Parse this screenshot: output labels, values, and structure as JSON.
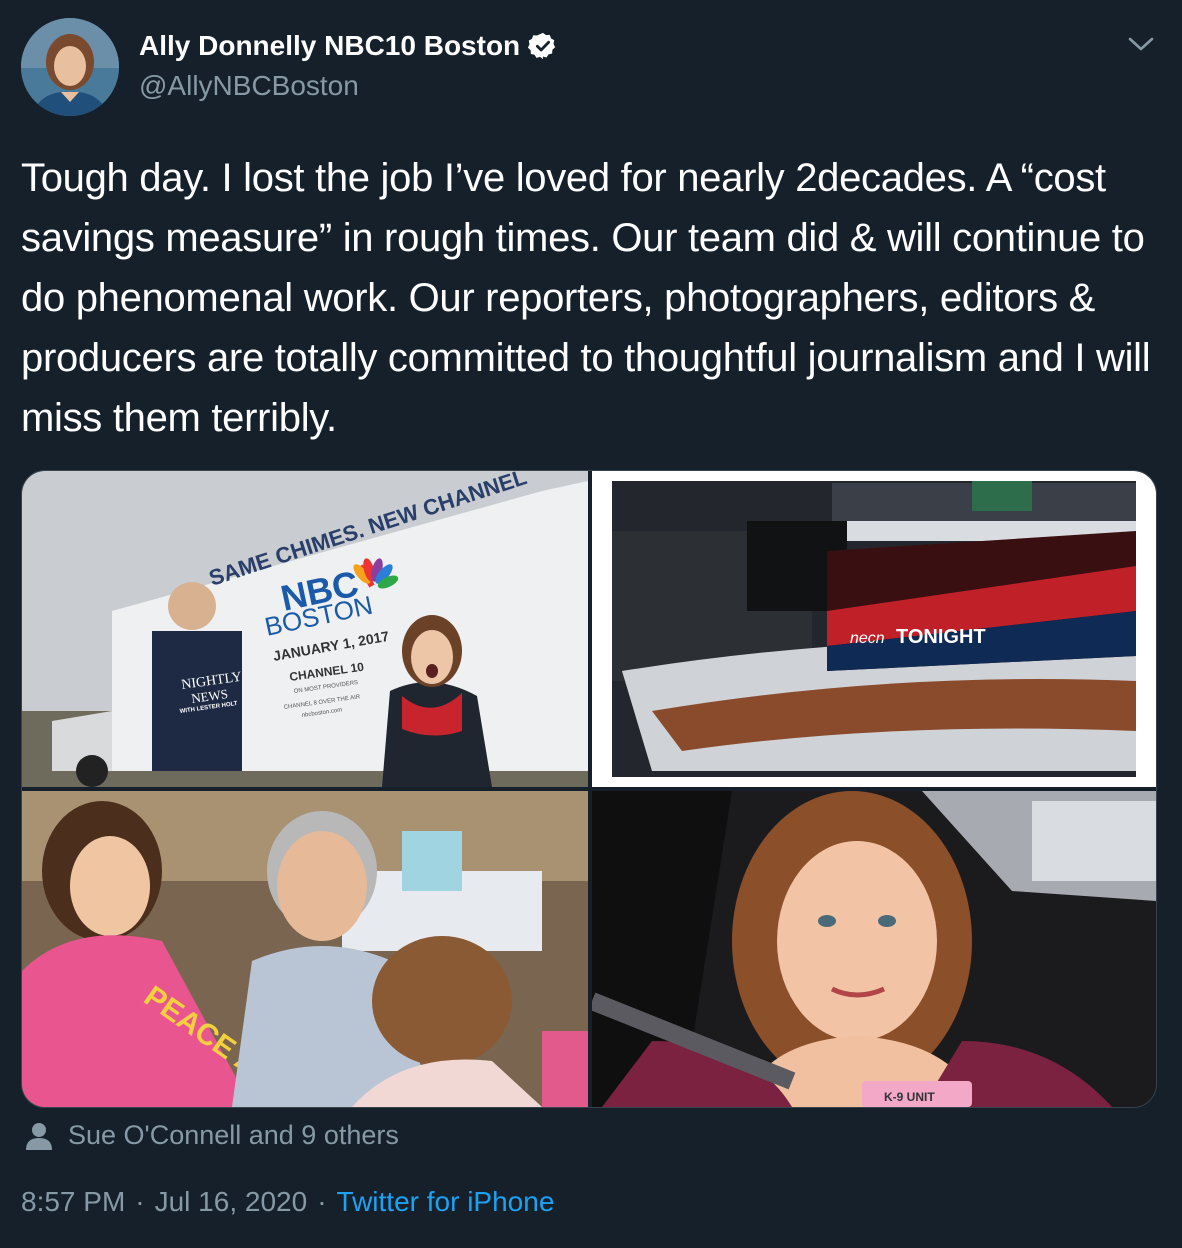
{
  "author": {
    "display_name": "Ally Donnelly NBC10 Boston",
    "handle": "@AllyNBCBoston",
    "verified": true,
    "avatar_icon": "avatar-photo"
  },
  "tweet": {
    "text": "Tough day. I lost the job I’ve loved for nearly 2decades. A “cost savings measure” in rough times. Our team did & will continue to do phenomenal work. Our reporters, photographers, editors & producers are totally committed to thoughtful journalism and I will miss them terribly."
  },
  "media": {
    "truck": {
      "slogan": "SAME CHIMES. NEW CHANNEL",
      "brand": "NBC",
      "city": "BOSTON",
      "date": "JANUARY 1, 2017",
      "channel": "CHANNEL 10",
      "providers": "ON MOST PROVIDERS",
      "channel_over": "CHANNEL 8 OVER THE AIR",
      "site": "nbcboston.com",
      "show_name": "NIGHTLY",
      "show_sub": "NEWS",
      "anchor_line": "WITH LESTER HOLT"
    },
    "studio": {
      "logo_prefix": "necn",
      "logo_text": "TONIGHT"
    },
    "kids": {
      "shirt_text": "PEACE AND LOVE"
    },
    "car": {
      "badge_text": "K-9 UNIT"
    }
  },
  "tagged": {
    "icon": "person-icon",
    "text": "Sue O'Connell and 9 others"
  },
  "meta": {
    "time": "8:57 PM",
    "separator": "·",
    "date": "Jul 16, 2020",
    "source": "Twitter for iPhone"
  },
  "colors": {
    "background": "#15202b",
    "secondary_text": "#8899a6",
    "link": "#1da1f2"
  }
}
